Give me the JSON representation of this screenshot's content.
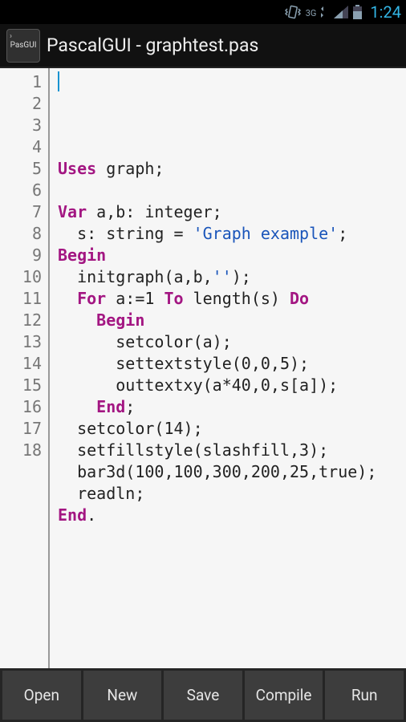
{
  "status": {
    "network": "3G",
    "clock": "1:24"
  },
  "header": {
    "icon_label": "PasGUI",
    "title": "PascalGUI - graphtest.pas"
  },
  "code": {
    "lines": [
      [
        {
          "t": ""
        }
      ],
      [
        {
          "t": "Uses",
          "c": "kw"
        },
        {
          "t": " graph;"
        }
      ],
      [
        {
          "t": ""
        }
      ],
      [
        {
          "t": "Var",
          "c": "kw"
        },
        {
          "t": " a,b: integer;"
        }
      ],
      [
        {
          "t": "  s: string = "
        },
        {
          "t": "'Graph example'",
          "c": "str"
        },
        {
          "t": ";"
        }
      ],
      [
        {
          "t": "Begin",
          "c": "kw"
        }
      ],
      [
        {
          "t": "  initgraph(a,b,"
        },
        {
          "t": "''",
          "c": "str"
        },
        {
          "t": ");"
        }
      ],
      [
        {
          "t": "  "
        },
        {
          "t": "For",
          "c": "kw"
        },
        {
          "t": " a:=1 "
        },
        {
          "t": "To",
          "c": "kw"
        },
        {
          "t": " length(s) "
        },
        {
          "t": "Do",
          "c": "kw"
        }
      ],
      [
        {
          "t": "    "
        },
        {
          "t": "Begin",
          "c": "kw"
        }
      ],
      [
        {
          "t": "      setcolor(a);"
        }
      ],
      [
        {
          "t": "      settextstyle(0,0,5);"
        }
      ],
      [
        {
          "t": "      outtextxy(a*40,0,s[a]);"
        }
      ],
      [
        {
          "t": "    "
        },
        {
          "t": "End",
          "c": "kw"
        },
        {
          "t": ";"
        }
      ],
      [
        {
          "t": "  setcolor(14);"
        }
      ],
      [
        {
          "t": "  setfillstyle(slashfill,3);"
        }
      ],
      [
        {
          "t": "  bar3d(100,100,300,200,25,true);"
        }
      ],
      [
        {
          "t": "  readln;"
        }
      ],
      [
        {
          "t": "End",
          "c": "kw"
        },
        {
          "t": "."
        }
      ]
    ]
  },
  "buttons": {
    "open": "Open",
    "new": "New",
    "save": "Save",
    "compile": "Compile",
    "run": "Run"
  }
}
